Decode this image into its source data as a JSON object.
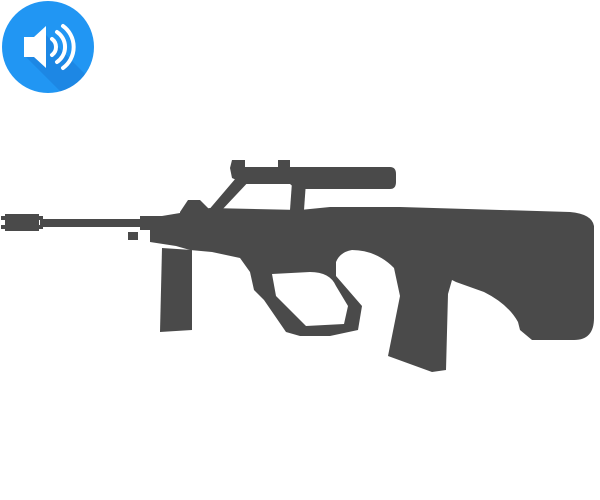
{
  "sound_button": {
    "icon": "speaker-volume-icon",
    "color": "#2196f3",
    "icon_color": "#ffffff"
  },
  "image": {
    "icon": "rifle-silhouette",
    "color": "#4a4a4a"
  }
}
